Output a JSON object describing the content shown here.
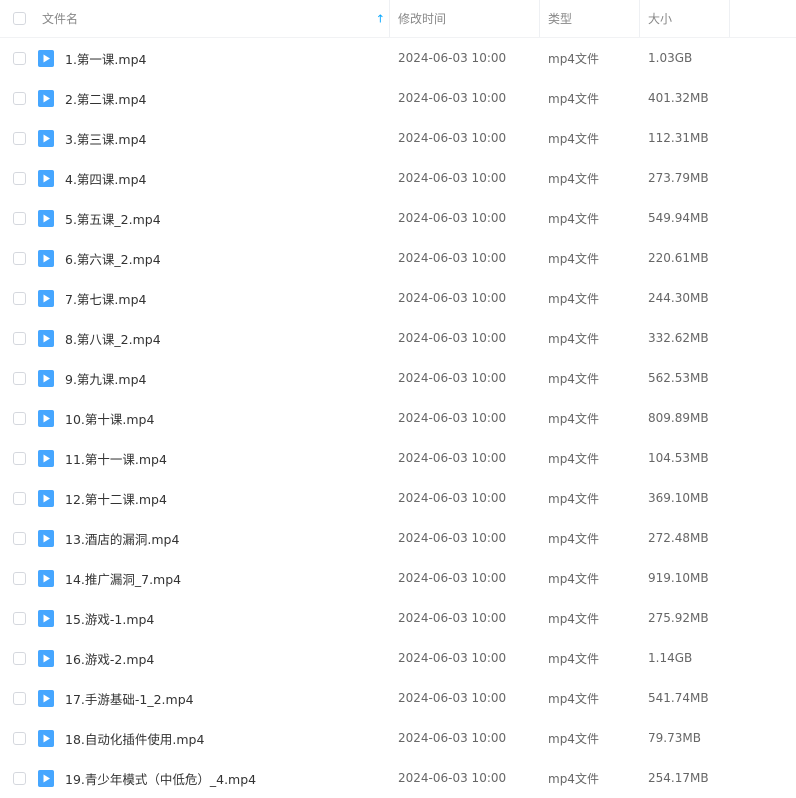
{
  "header": {
    "name_label": "文件名",
    "time_label": "修改时间",
    "type_label": "类型",
    "size_label": "大小",
    "sort_icon": "arrow-up-icon",
    "sort_glyph": "↑"
  },
  "colors": {
    "accent": "#06a7ff",
    "file_icon": "#46a6ff"
  },
  "files": [
    {
      "name": "1.第一课.mp4",
      "time": "2024-06-03 10:00",
      "type": "mp4文件",
      "size": "1.03GB"
    },
    {
      "name": "2.第二课.mp4",
      "time": "2024-06-03 10:00",
      "type": "mp4文件",
      "size": "401.32MB"
    },
    {
      "name": "3.第三课.mp4",
      "time": "2024-06-03 10:00",
      "type": "mp4文件",
      "size": "112.31MB"
    },
    {
      "name": "4.第四课.mp4",
      "time": "2024-06-03 10:00",
      "type": "mp4文件",
      "size": "273.79MB"
    },
    {
      "name": "5.第五课_2.mp4",
      "time": "2024-06-03 10:00",
      "type": "mp4文件",
      "size": "549.94MB"
    },
    {
      "name": "6.第六课_2.mp4",
      "time": "2024-06-03 10:00",
      "type": "mp4文件",
      "size": "220.61MB"
    },
    {
      "name": "7.第七课.mp4",
      "time": "2024-06-03 10:00",
      "type": "mp4文件",
      "size": "244.30MB"
    },
    {
      "name": "8.第八课_2.mp4",
      "time": "2024-06-03 10:00",
      "type": "mp4文件",
      "size": "332.62MB"
    },
    {
      "name": "9.第九课.mp4",
      "time": "2024-06-03 10:00",
      "type": "mp4文件",
      "size": "562.53MB"
    },
    {
      "name": "10.第十课.mp4",
      "time": "2024-06-03 10:00",
      "type": "mp4文件",
      "size": "809.89MB"
    },
    {
      "name": "11.第十一课.mp4",
      "time": "2024-06-03 10:00",
      "type": "mp4文件",
      "size": "104.53MB"
    },
    {
      "name": "12.第十二课.mp4",
      "time": "2024-06-03 10:00",
      "type": "mp4文件",
      "size": "369.10MB"
    },
    {
      "name": "13.酒店的漏洞.mp4",
      "time": "2024-06-03 10:00",
      "type": "mp4文件",
      "size": "272.48MB"
    },
    {
      "name": "14.推广漏洞_7.mp4",
      "time": "2024-06-03 10:00",
      "type": "mp4文件",
      "size": "919.10MB"
    },
    {
      "name": "15.游戏-1.mp4",
      "time": "2024-06-03 10:00",
      "type": "mp4文件",
      "size": "275.92MB"
    },
    {
      "name": "16.游戏-2.mp4",
      "time": "2024-06-03 10:00",
      "type": "mp4文件",
      "size": "1.14GB"
    },
    {
      "name": "17.手游基础-1_2.mp4",
      "time": "2024-06-03 10:00",
      "type": "mp4文件",
      "size": "541.74MB"
    },
    {
      "name": "18.自动化插件使用.mp4",
      "time": "2024-06-03 10:00",
      "type": "mp4文件",
      "size": "79.73MB"
    },
    {
      "name": "19.青少年模式（中低危）_4.mp4",
      "time": "2024-06-03 10:00",
      "type": "mp4文件",
      "size": "254.17MB"
    }
  ]
}
